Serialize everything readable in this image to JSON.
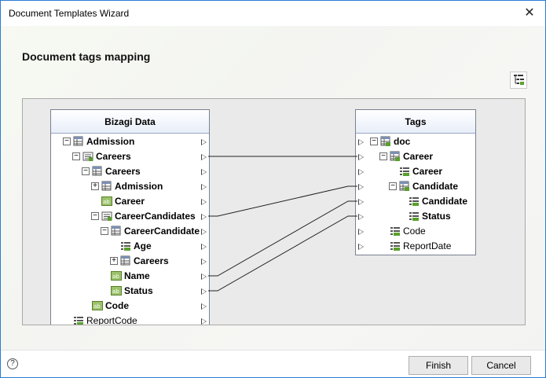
{
  "window": {
    "title": "Document Templates Wizard",
    "close_glyph": "✕"
  },
  "page": {
    "heading": "Document tags mapping"
  },
  "toolbar": {
    "layout_icon": "tree-layout-icon"
  },
  "left_panel": {
    "title": "Bizagi Data",
    "rows": [
      {
        "label": "Admission",
        "expander": "−",
        "icon": "entity-icon",
        "bold": true
      },
      {
        "label": "Careers",
        "expander": "−",
        "icon": "collection-icon",
        "bold": true
      },
      {
        "label": "Careers",
        "expander": "−",
        "icon": "entity-icon",
        "bold": true
      },
      {
        "label": "Admission",
        "expander": "+",
        "icon": "entity-icon",
        "bold": true
      },
      {
        "label": "Career",
        "expander": "",
        "icon": "text-attribute-icon",
        "bold": true
      },
      {
        "label": "CareerCandidates",
        "expander": "−",
        "icon": "collection-icon",
        "bold": true
      },
      {
        "label": "CareerCandidate",
        "expander": "−",
        "icon": "entity-icon",
        "bold": true
      },
      {
        "label": "Age",
        "expander": "",
        "icon": "list-attribute-icon",
        "bold": true
      },
      {
        "label": "Careers",
        "expander": "+",
        "icon": "entity-icon",
        "bold": true
      },
      {
        "label": "Name",
        "expander": "",
        "icon": "text-attribute-icon",
        "bold": true
      },
      {
        "label": "Status",
        "expander": "",
        "icon": "text-attribute-icon",
        "bold": true
      },
      {
        "label": "Code",
        "expander": "",
        "icon": "text-attribute-icon",
        "bold": true
      },
      {
        "label": "ReportCode",
        "expander": "",
        "icon": "list-attribute-icon",
        "bold": false
      }
    ]
  },
  "right_panel": {
    "title": "Tags",
    "rows": [
      {
        "label": "doc",
        "expander": "−",
        "icon": "table-tag-icon",
        "bold": true
      },
      {
        "label": "Career",
        "expander": "−",
        "icon": "table-tag-icon",
        "bold": true
      },
      {
        "label": "Career",
        "expander": "",
        "icon": "field-tag-icon",
        "bold": true
      },
      {
        "label": "Candidate",
        "expander": "−",
        "icon": "table-tag-icon",
        "bold": true
      },
      {
        "label": "Candidate",
        "expander": "",
        "icon": "field-tag-icon",
        "bold": true
      },
      {
        "label": "Status",
        "expander": "",
        "icon": "field-tag-icon",
        "bold": true
      },
      {
        "label": "Code",
        "expander": "",
        "icon": "field-tag-icon",
        "bold": false
      },
      {
        "label": "ReportDate",
        "expander": "",
        "icon": "field-tag-icon",
        "bold": false
      }
    ]
  },
  "mappings": [
    {
      "from": "Careers",
      "to": "Career"
    },
    {
      "from": "CareerCandidates",
      "to": "Candidate"
    },
    {
      "from": "Name",
      "to": "Candidate"
    },
    {
      "from": "Status",
      "to": "Status"
    }
  ],
  "footer": {
    "help_glyph": "?",
    "finish_label": "Finish",
    "cancel_label": "Cancel"
  }
}
